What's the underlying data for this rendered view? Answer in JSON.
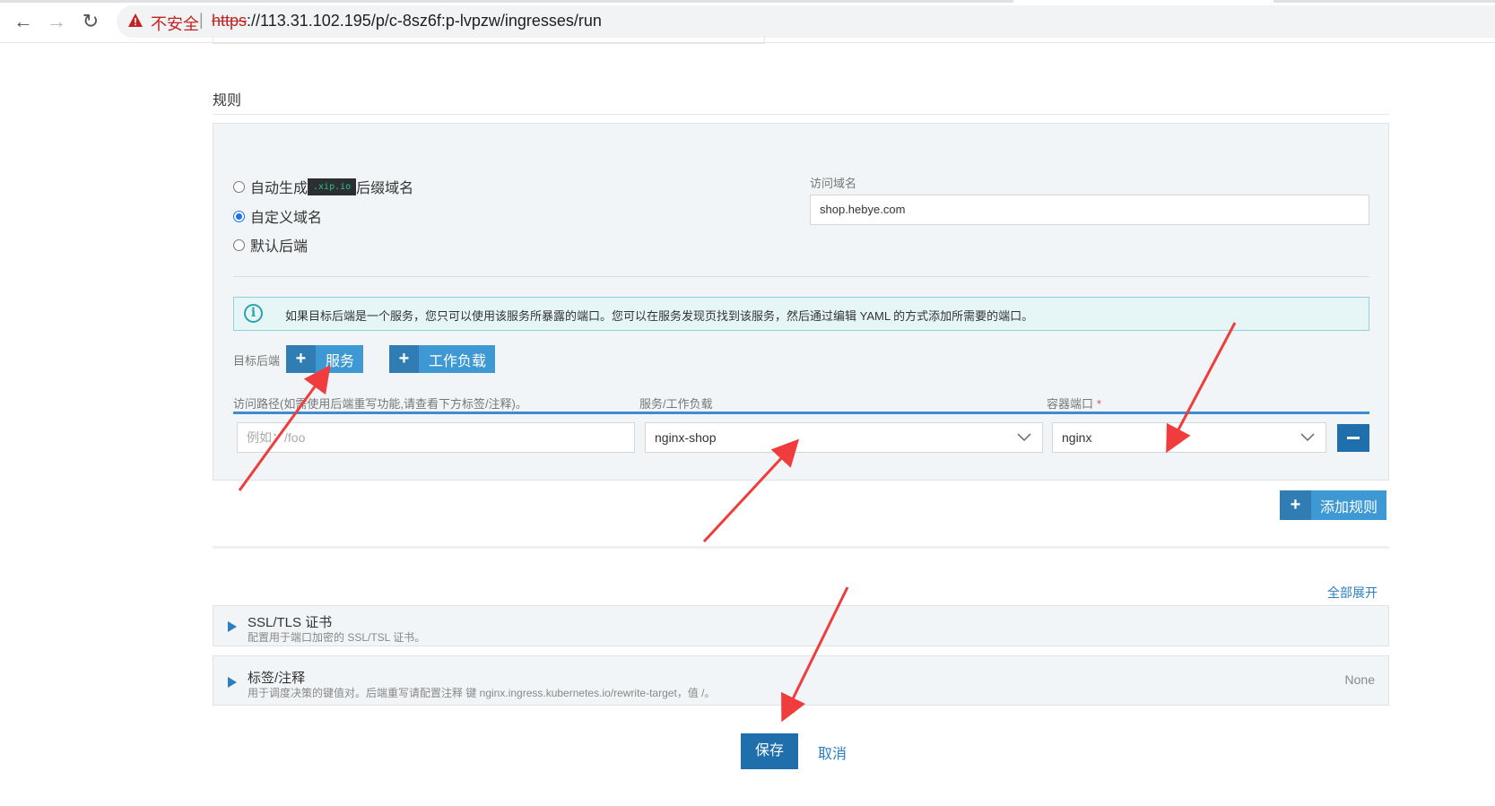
{
  "browser": {
    "security_label": "不安全",
    "url_scheme": "https",
    "url_rest": "://113.31.102.195/p/c-8sz6f:p-lvpzw/ingresses/run"
  },
  "rules_section": {
    "title": "规则",
    "domain_options": [
      {
        "prefix": "自动生成",
        "chip": ".xip.io",
        "suffix": "后缀域名",
        "selected": false
      },
      {
        "label": "自定义域名",
        "selected": true
      },
      {
        "label": "默认后端",
        "selected": false
      }
    ],
    "hostname_label": "访问域名",
    "hostname_value": "shop.hebye.com",
    "info_text": "如果目标后端是一个服务，您只可以使用该服务所暴露的端口。您可以在服务发现页找到该服务，然后通过编辑 YAML 的方式添加所需要的端口。",
    "target_backend_label": "目标后端",
    "add_service_label": "服务",
    "add_workload_label": "工作负载",
    "columns": {
      "path": "访问路径(如需使用后端重写功能,请查看下方标签/注释)。",
      "service": "服务/工作负载",
      "port": "容器端口"
    },
    "row": {
      "path_placeholder": "例如：/foo",
      "service_value": "nginx-shop",
      "port_value": "nginx"
    },
    "add_rule_label": "添加规则"
  },
  "expand_all_label": "全部展开",
  "accordions": [
    {
      "title": "SSL/TLS 证书",
      "description": "配置用于端口加密的 SSL/TSL 证书。",
      "right": ""
    },
    {
      "title": "标签/注释",
      "description": "用于调度决策的键值对。后端重写请配置注释 键 nginx.ingress.kubernetes.io/rewrite-target，值 /。",
      "right": "None"
    }
  ],
  "footer": {
    "save_label": "保存",
    "cancel_label": "取消"
  },
  "colors": {
    "primary": "#3d98d3",
    "primary_dark": "#1f6fad",
    "annotation_arrow": "#f03c3c"
  }
}
